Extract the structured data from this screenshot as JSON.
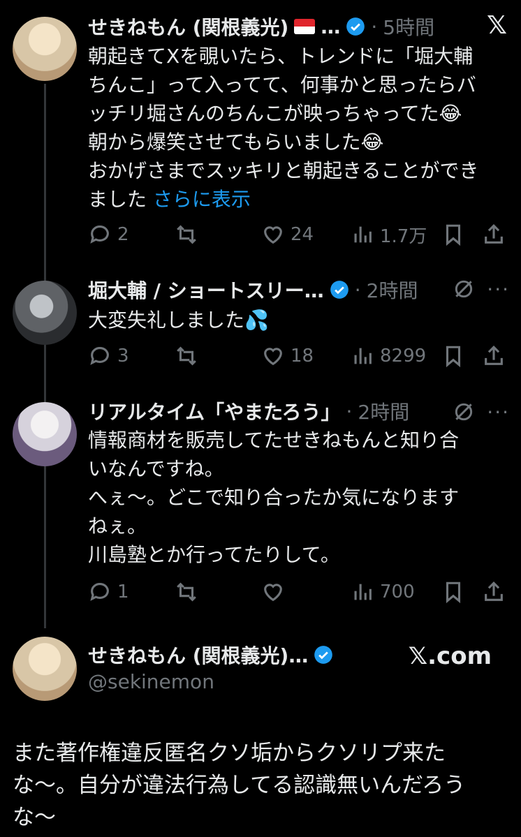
{
  "tweets": [
    {
      "name": "せきねもん (関根義光)",
      "ellipsis": "…",
      "separator": "·",
      "time": "5時間",
      "text_lines": [
        "朝起きてXを覗いたら、トレンドに「堀大輔",
        "ちんこ」って入ってて、何事かと思ったらバ",
        "ッチリ堀さんのちんこが映っちゃってた😂",
        "朝から爆笑させてもらいました😂",
        "おかげさまでスッキリと朝起きることができ"
      ],
      "last_line": "ました ",
      "show_more": "さらに表示",
      "replies": "2",
      "likes": "24",
      "views": "1.7万"
    },
    {
      "name": "堀大輔 / ショートスリー…",
      "separator": "·",
      "time": "2時間",
      "text": "大変失礼しました💦",
      "replies": "3",
      "likes": "18",
      "views": "8299"
    },
    {
      "name": "リアルタイム「やまたろう」",
      "separator": "·",
      "time": "2時間",
      "text_lines": [
        "情報商材を販売してたせきねもんと知り合",
        "いなんですね。",
        "へぇ〜。どこで知り合ったか気になります",
        "ねぇ。",
        "川島塾とか行ってたりして。"
      ],
      "replies": "1",
      "likes": "",
      "views": "700"
    }
  ],
  "quoted": {
    "name": "せきねもん (関根義光)…",
    "handle": "@sekinemon",
    "brand": "𝕏.com",
    "text_lines": [
      "また著作権違反匿名クソ垢からクソリプ来た",
      "な〜。自分が違法行為してる認識無いんだろう",
      "な〜"
    ]
  },
  "icons": {
    "x_logo": "𝕏",
    "more": "···",
    "accent": "#1d9bf0"
  }
}
